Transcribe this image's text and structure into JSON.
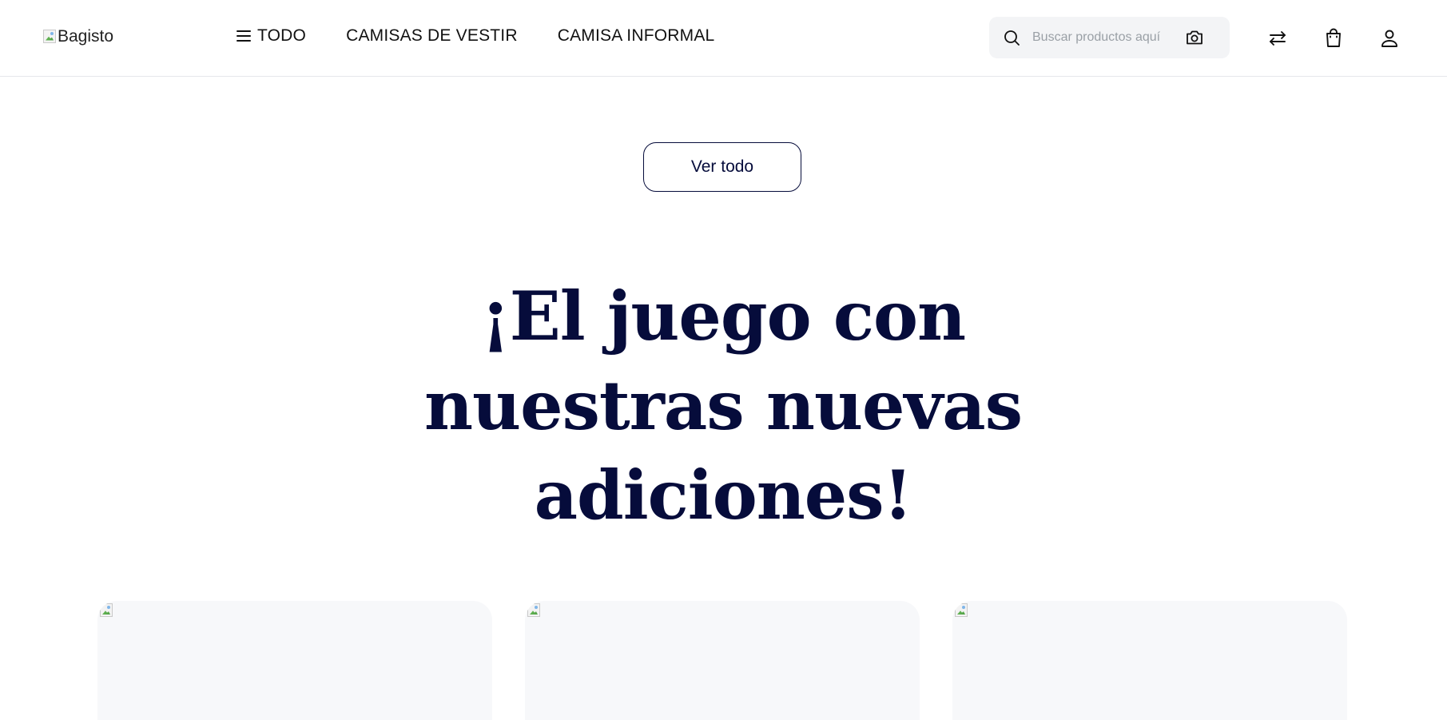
{
  "header": {
    "logo_alt": "Bagisto",
    "nav": {
      "all_label": "TODO",
      "items": [
        "CAMISAS DE VESTIR",
        "CAMISA INFORMAL"
      ]
    },
    "search": {
      "placeholder": "Buscar productos aquí",
      "value": ""
    },
    "icons": [
      "search-icon",
      "camera-icon",
      "compare-icon",
      "shopping-bag-icon",
      "user-icon"
    ]
  },
  "main": {
    "view_all_label": "Ver todo",
    "headline": "¡El juego con nuestras nuevas adiciones!",
    "product_cards": [
      {
        "image": "broken-image"
      },
      {
        "image": "broken-image"
      },
      {
        "image": "broken-image"
      }
    ]
  },
  "colors": {
    "brand_navy": "#060c3b",
    "search_bg": "#f3f4f6",
    "card_bg": "#f7f8fa"
  }
}
